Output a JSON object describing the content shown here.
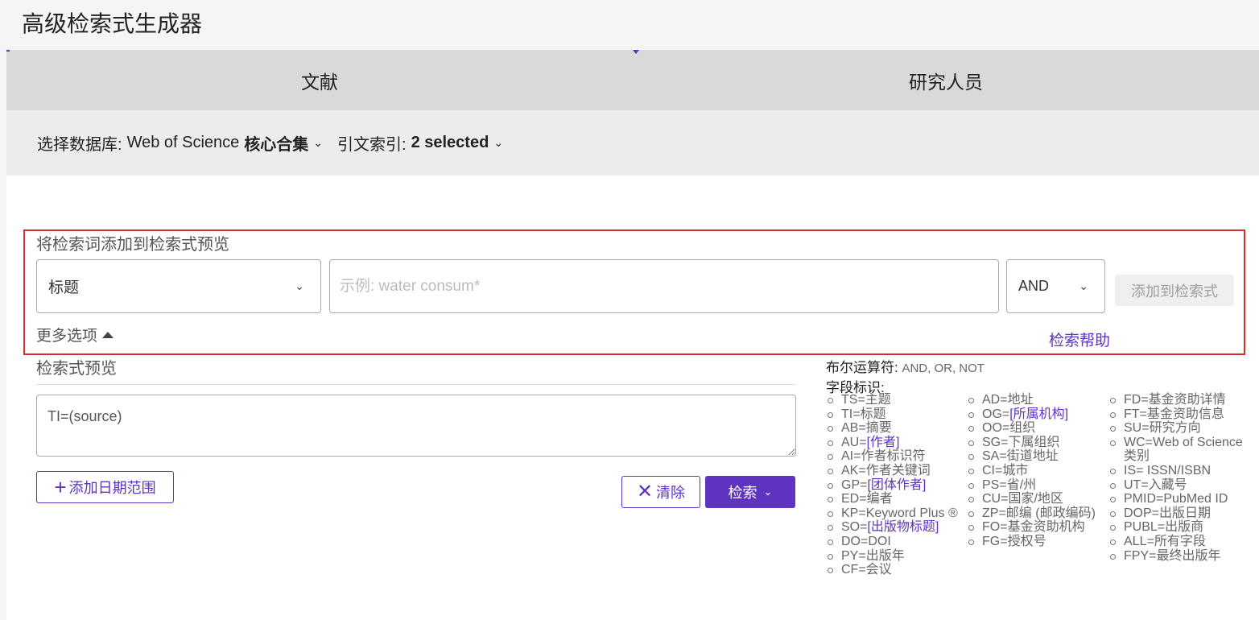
{
  "page_title": "高级检索式生成器",
  "tabs": [
    {
      "label": "文献",
      "active": true
    },
    {
      "label": "研究人员",
      "active": false
    }
  ],
  "database": {
    "db_label": "选择数据库:",
    "db_value_en": "Web of Science",
    "db_value_cn": "核心合集",
    "index_label": "引文索引:",
    "index_value": "2 selected"
  },
  "builder": {
    "title": "将检索词添加到检索式预览",
    "field_value": "标题",
    "term_placeholder": "示例: water consum*",
    "operator_value": "AND",
    "add_button": "添加到检索式",
    "more_options": "更多选项",
    "help_link": "检索帮助"
  },
  "preview": {
    "title": "检索式预览",
    "query": "TI=(source)",
    "add_date_range": "添加日期范围",
    "clear_button": "清除",
    "search_button": "检索"
  },
  "help": {
    "boolean_label": "布尔运算符",
    "boolean_values": "AND, OR, NOT",
    "fields_label": "字段标识",
    "columns": [
      [
        {
          "code": "TS=",
          "name": "主题",
          "link": false
        },
        {
          "code": "TI=",
          "name": "标题",
          "link": false
        },
        {
          "code": "AB=",
          "name": "摘要",
          "link": false
        },
        {
          "code": "AU=",
          "name": "[作者]",
          "link": true
        },
        {
          "code": "AI=",
          "name": "作者标识符",
          "link": false
        },
        {
          "code": "AK=",
          "name": "作者关键词",
          "link": false
        },
        {
          "code": "GP=",
          "name": "[团体作者]",
          "link": true
        },
        {
          "code": "ED=",
          "name": "编者",
          "link": false
        },
        {
          "code": "KP=",
          "name": "Keyword Plus ®",
          "link": false
        },
        {
          "code": "SO=",
          "name": "[出版物标题]",
          "link": true
        },
        {
          "code": "DO=",
          "name": "DOI",
          "link": false
        },
        {
          "code": "PY=",
          "name": "出版年",
          "link": false
        },
        {
          "code": "CF=",
          "name": "会议",
          "link": false
        }
      ],
      [
        {
          "code": "AD=",
          "name": "地址",
          "link": false
        },
        {
          "code": "OG=",
          "name": "[所属机构]",
          "link": true
        },
        {
          "code": "OO=",
          "name": "组织",
          "link": false
        },
        {
          "code": "SG=",
          "name": "下属组织",
          "link": false
        },
        {
          "code": "SA=",
          "name": "街道地址",
          "link": false
        },
        {
          "code": "CI=",
          "name": "城市",
          "link": false
        },
        {
          "code": "PS=",
          "name": "省/州",
          "link": false
        },
        {
          "code": "CU=",
          "name": "国家/地区",
          "link": false
        },
        {
          "code": "ZP=",
          "name": "邮编 (邮政编码)",
          "link": false
        },
        {
          "code": "FO=",
          "name": "基金资助机构",
          "link": false
        },
        {
          "code": "FG=",
          "name": "授权号",
          "link": false
        }
      ],
      [
        {
          "code": "FD=",
          "name": "基金资助详情",
          "link": false
        },
        {
          "code": "FT=",
          "name": "基金资助信息",
          "link": false
        },
        {
          "code": "SU=",
          "name": "研究方向",
          "link": false
        },
        {
          "code": "WC=",
          "name": "Web of Science 类别",
          "link": false
        },
        {
          "code": "IS=",
          "name": " ISSN/ISBN",
          "link": false
        },
        {
          "code": "UT=",
          "name": "入藏号",
          "link": false
        },
        {
          "code": "PMID=",
          "name": "PubMed ID",
          "link": false
        },
        {
          "code": "DOP=",
          "name": "出版日期",
          "link": false
        },
        {
          "code": "PUBL=",
          "name": "出版商",
          "link": false
        },
        {
          "code": "ALL=",
          "name": "所有字段",
          "link": false
        },
        {
          "code": "FPY=",
          "name": "最终出版年",
          "link": false
        }
      ]
    ]
  }
}
